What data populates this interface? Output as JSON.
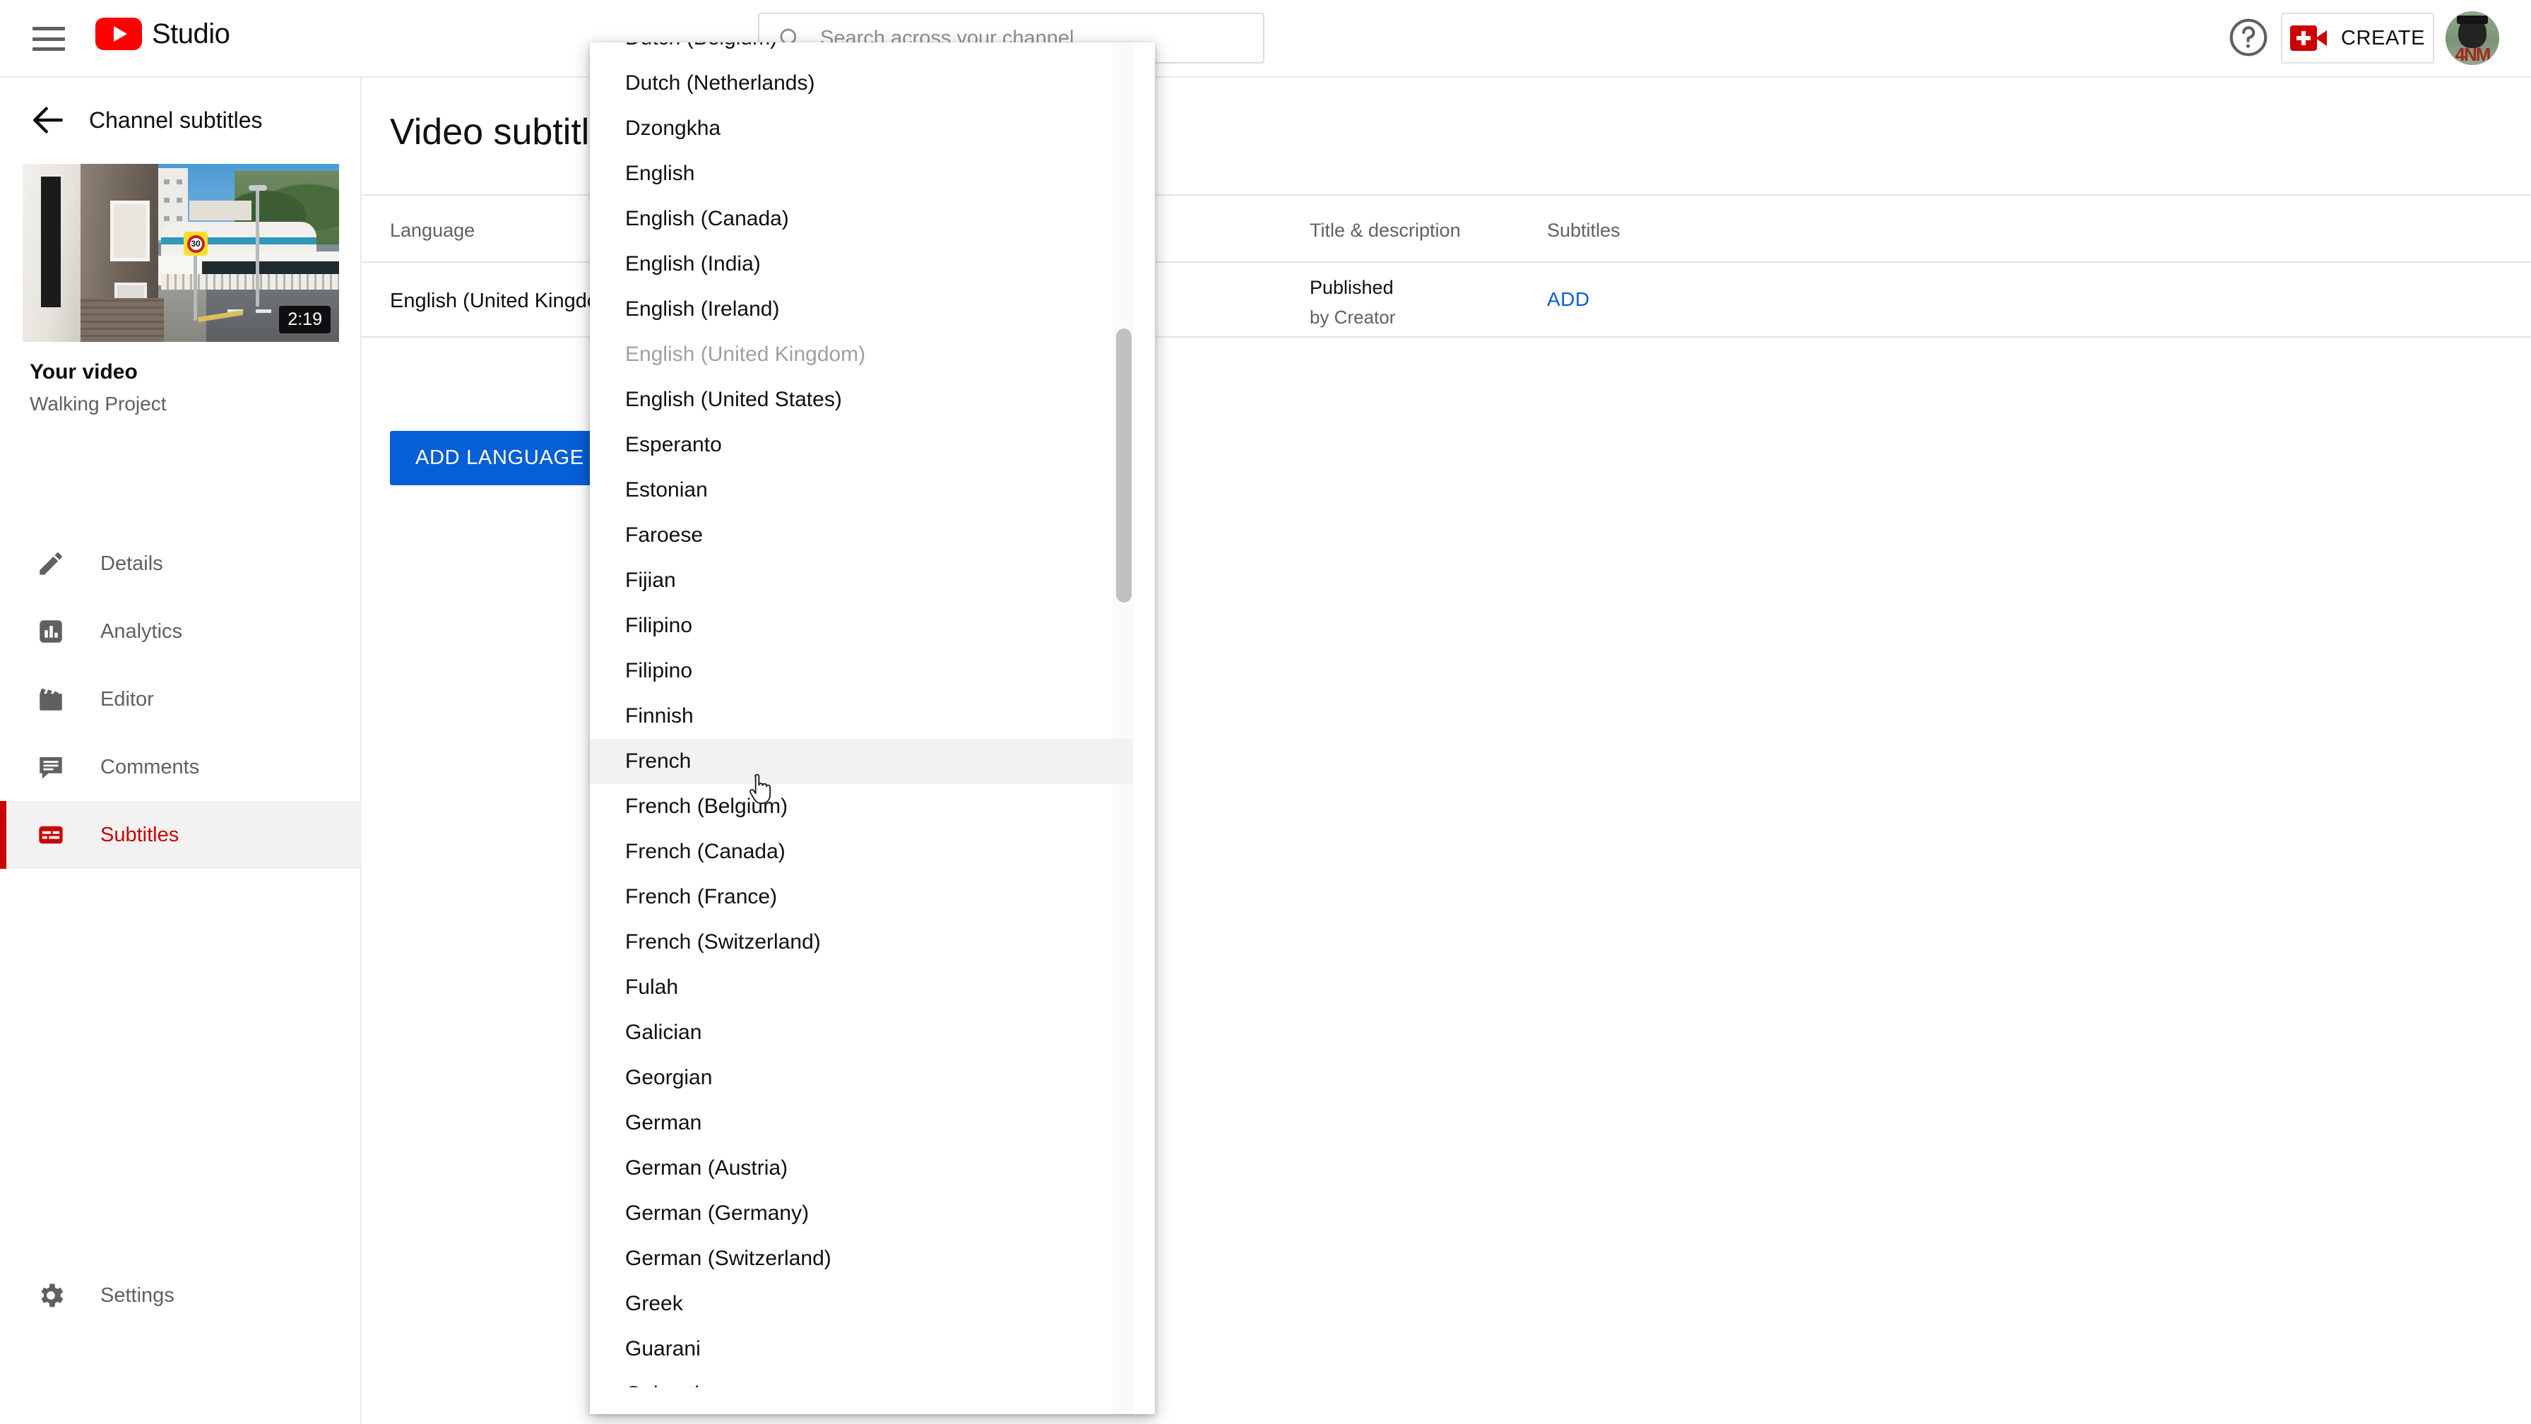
{
  "header": {
    "menu_icon": "hamburger-icon",
    "logo_text": "Studio",
    "search": {
      "icon": "search-icon",
      "placeholder": "Search across your channel",
      "value": ""
    },
    "help_icon": "help-circle-icon",
    "create_button": {
      "label": "CREATE",
      "icon": "video-camera-plus-icon"
    },
    "avatar": {
      "icon": "avatar",
      "initials": "4NM"
    }
  },
  "sidebar": {
    "back_icon": "back-arrow-icon",
    "title": "Channel subtitles",
    "video": {
      "duration": "2:19",
      "title": "Your video",
      "subtitle": "Walking Project"
    },
    "items": [
      {
        "label": "Details",
        "icon": "pencil-icon",
        "active": false
      },
      {
        "label": "Analytics",
        "icon": "bar-chart-icon",
        "active": false
      },
      {
        "label": "Editor",
        "icon": "clapperboard-icon",
        "active": false
      },
      {
        "label": "Comments",
        "icon": "comment-icon",
        "active": false
      },
      {
        "label": "Subtitles",
        "icon": "subtitles-icon",
        "active": true
      }
    ],
    "settings": {
      "label": "Settings",
      "icon": "gear-icon"
    }
  },
  "main": {
    "page_title": "Video subtitles",
    "table": {
      "columns": [
        "Language",
        "Title & description",
        "Subtitles"
      ],
      "rows": [
        {
          "language": "English (United Kingdom)",
          "title_status": "Published",
          "title_by": "by Creator",
          "subtitles_action": "ADD"
        }
      ]
    },
    "add_language_button": "ADD LANGUAGE"
  },
  "dropdown": {
    "hovered_item": "French",
    "disabled_item": "English (United Kingdom)",
    "items": [
      "Dutch (Belgium)",
      "Dutch (Netherlands)",
      "Dzongkha",
      "English",
      "English (Canada)",
      "English (India)",
      "English (Ireland)",
      "English (United Kingdom)",
      "English (United States)",
      "Esperanto",
      "Estonian",
      "Faroese",
      "Fijian",
      "Filipino",
      "Filipino",
      "Finnish",
      "French",
      "French (Belgium)",
      "French (Canada)",
      "French (France)",
      "French (Switzerland)",
      "Fulah",
      "Galician",
      "Georgian",
      "German",
      "German (Austria)",
      "German (Germany)",
      "German (Switzerland)",
      "Greek",
      "Guarani",
      "Gujarati"
    ]
  },
  "colors": {
    "brand_red": "#cc0000",
    "link_blue": "#065fd4",
    "text_primary": "#0f0f0f",
    "text_secondary": "#606060",
    "border": "#e5e5e5",
    "hover_bg": "#f2f2f2"
  }
}
